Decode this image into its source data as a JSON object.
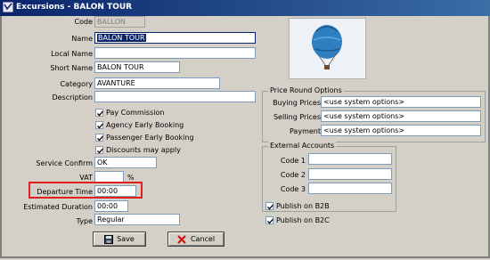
{
  "window": {
    "title": "Excursions - BALON TOUR"
  },
  "form": {
    "code": {
      "label": "Code",
      "value": "BALLON"
    },
    "name": {
      "label": "Name",
      "value": "BALON TOUR"
    },
    "local_name": {
      "label": "Local Name",
      "value": ""
    },
    "short_name": {
      "label": "Short Name",
      "value": "BALON TOUR"
    },
    "category": {
      "label": "Category",
      "value": "AVANTURE"
    },
    "description": {
      "label": "Description",
      "value": ""
    },
    "checkboxes": [
      {
        "label": "Pay Commission",
        "checked": true
      },
      {
        "label": "Agency Early Booking",
        "checked": true
      },
      {
        "label": "Passenger Early Booking",
        "checked": true
      },
      {
        "label": "Discounts may apply",
        "checked": true
      }
    ],
    "service_confirm": {
      "label": "Service Confirm",
      "value": "OK"
    },
    "vat": {
      "label": "VAT",
      "value": "",
      "unit": "%"
    },
    "departure_time": {
      "label": "Departure Time",
      "value": "00:00"
    },
    "estimated_duration": {
      "label": "Estimated Duration",
      "value": "00:00"
    },
    "type": {
      "label": "Type",
      "value": "Regular"
    }
  },
  "price_round": {
    "title": "Price Round Options",
    "buying": {
      "label": "Buying Prices",
      "value": "<use system options>"
    },
    "selling": {
      "label": "Selling Prices",
      "value": "<use system options>"
    },
    "payment": {
      "label": "Payment",
      "value": "<use system options>"
    }
  },
  "external": {
    "title": "External Accounts",
    "code1": {
      "label": "Code 1",
      "value": ""
    },
    "code2": {
      "label": "Code 2",
      "value": ""
    },
    "code3": {
      "label": "Code 3",
      "value": ""
    }
  },
  "publish": [
    {
      "label": "Publish on B2B",
      "checked": true
    },
    {
      "label": "Publish on B2C",
      "checked": true
    }
  ],
  "buttons": {
    "save": "Save",
    "cancel": "Cancel"
  },
  "colors": {
    "title_bar": "#0a246a",
    "highlight_box": "#e02020",
    "balloon": "#2f7fc0"
  }
}
